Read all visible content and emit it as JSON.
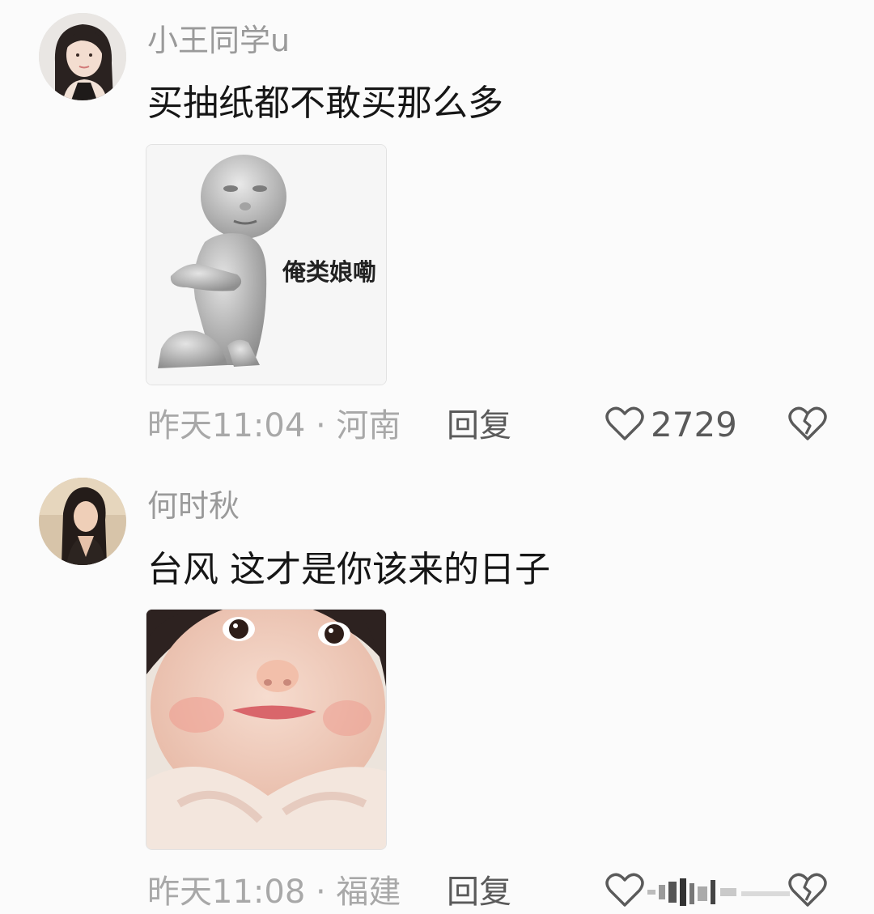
{
  "comments": [
    {
      "username": "小王同学u",
      "text": "买抽纸都不敢买那么多",
      "sticker_caption": "俺类娘嘞",
      "time_location": "昨天11:04 · 河南",
      "reply_label": "回复",
      "likes": "2729",
      "icons": [
        "avatar",
        "meme-sticker",
        "heart-icon",
        "broken-heart-icon"
      ]
    },
    {
      "username": "何时秋",
      "text": "台风 这才是你该来的日子",
      "time_location": "昨天11:08 · 福建",
      "reply_label": "回复",
      "icons": [
        "avatar",
        "baby-face-sticker",
        "heart-icon",
        "broken-heart-icon"
      ]
    }
  ],
  "colors": {
    "background": "#fbfbfb",
    "username": "#9a9a9a",
    "text": "#161616",
    "meta": "#a8a8a8",
    "action": "#5a5a5a"
  }
}
